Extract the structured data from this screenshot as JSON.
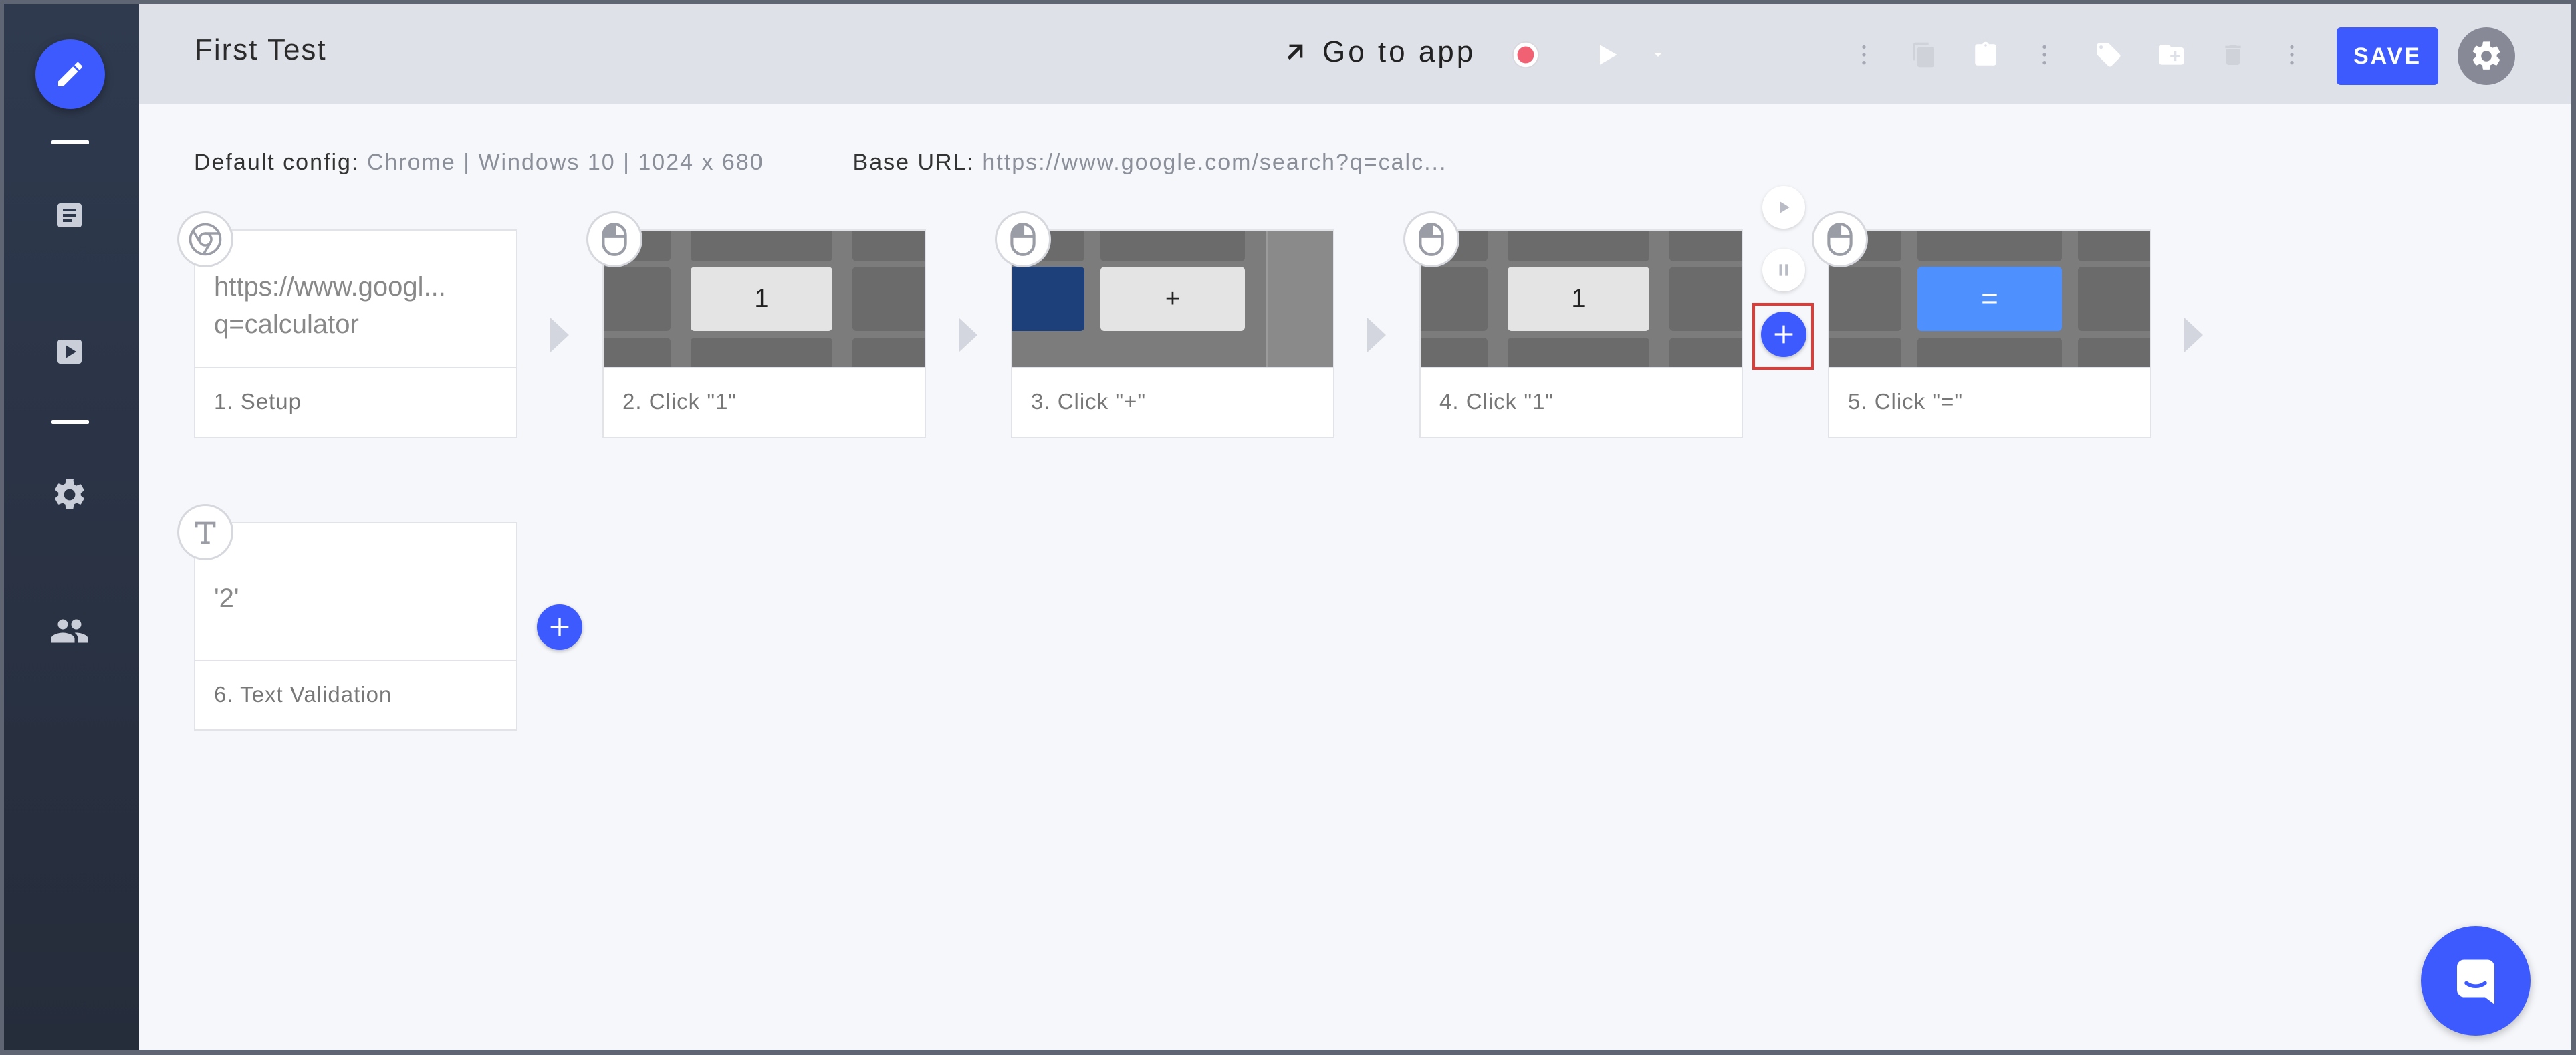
{
  "header": {
    "title": "First Test",
    "go_to_app_label": "Go to app",
    "save_label": "SAVE"
  },
  "config": {
    "default_config_label": "Default config:",
    "default_config_value": "Chrome | Windows 10 | 1024 x 680",
    "base_url_label": "Base URL:",
    "base_url_value": "https://www.google.com/search?q=calc..."
  },
  "steps": [
    {
      "caption": "1. Setup",
      "url_line1": "https://www.googl...",
      "url_line2": "q=calculator",
      "icon": "chrome-icon"
    },
    {
      "caption": "2. Click \"1\"",
      "key_label": "1",
      "icon": "mouse-icon"
    },
    {
      "caption": "3. Click \"+\"",
      "key_label": "+",
      "icon": "mouse-icon"
    },
    {
      "caption": "4. Click \"1\"",
      "key_label": "1",
      "icon": "mouse-icon"
    },
    {
      "caption": "5. Click \"=\"",
      "key_label": "=",
      "icon": "mouse-icon"
    },
    {
      "caption": "6. Text Validation",
      "value": "'2'",
      "icon": "text-icon"
    }
  ],
  "colors": {
    "accent": "#3d5afe",
    "record": "#f06174",
    "highlight": "#e53935",
    "sidebar": "#2b3445"
  }
}
